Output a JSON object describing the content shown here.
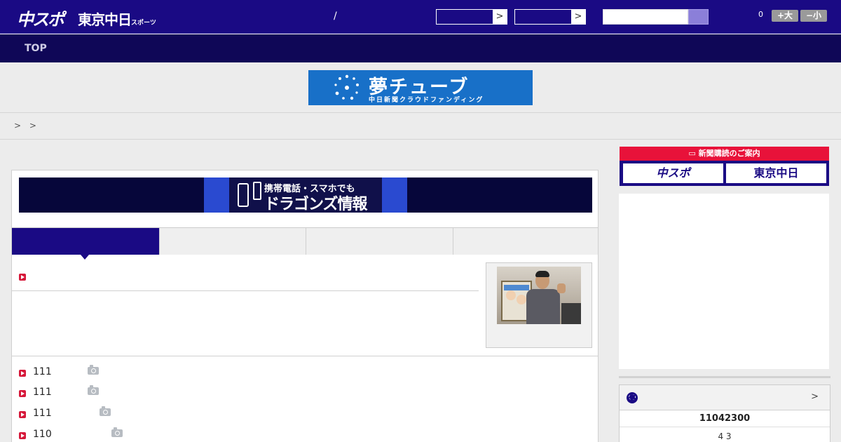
{
  "header": {
    "logo_main": "中スポ",
    "logo_tokyo": "東京中日",
    "logo_tokyo_small": "スポーツ",
    "slash": "/",
    "select1_arrow": ">",
    "select2_arrow": ">",
    "font_count": "0",
    "font_up_label": "+大",
    "font_down_label": "−小"
  },
  "nav": {
    "top_label": "TOP"
  },
  "banner_yume": {
    "title": "夢チューブ",
    "subtitle": "中日新聞クラウドファンディング"
  },
  "breadcrumb": [
    ">",
    ">"
  ],
  "mobile_banner": {
    "line1": "携帯電話・スマホでも",
    "line2": "ドラゴンズ情報"
  },
  "news": [
    {
      "num": "111"
    },
    {
      "num": "111"
    },
    {
      "num": "111"
    },
    {
      "num": "110"
    }
  ],
  "subscribe": {
    "heading": "新聞購読のご案内",
    "btn1": "中スポ",
    "btn2": "東京中日"
  },
  "score": {
    "more": ">",
    "date": "11042300",
    "score": "4  3"
  },
  "colors": {
    "header_bg": "#1a0a84",
    "nav_bg": "#0f0757",
    "accent_red": "#d6183a",
    "banner_blue": "#1870c8"
  }
}
